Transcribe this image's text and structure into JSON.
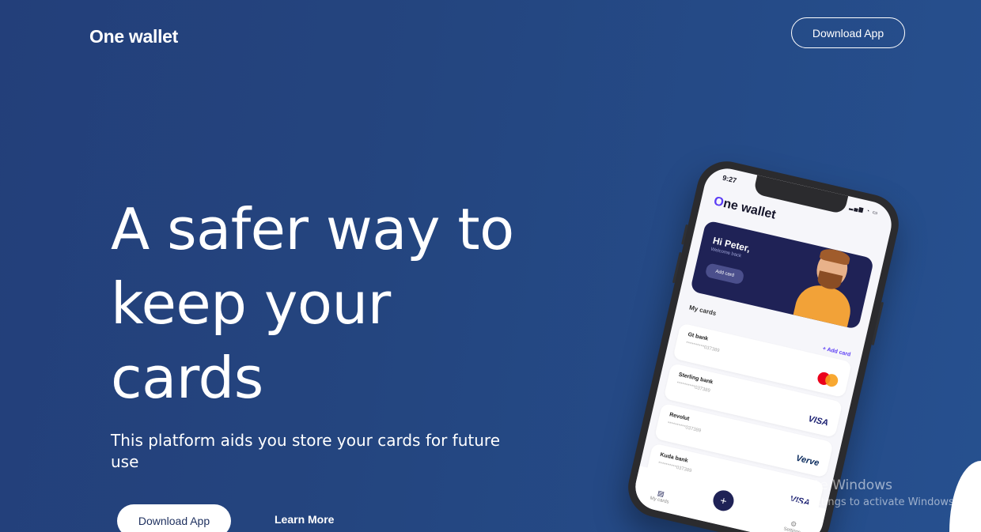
{
  "header": {
    "logo": "One wallet",
    "download_label": "Download App"
  },
  "hero": {
    "title": "A safer way to keep your cards",
    "subtitle": "This platform aids you store your cards for future use",
    "primary_button": "Download App",
    "secondary_link": "Learn More"
  },
  "phone": {
    "status_time": "9:27",
    "app_logo_rest": "ne wallet",
    "app_logo_o": "O",
    "greeting": "Hi Peter,",
    "welcome": "Welcome back",
    "add_card_button": "Add card",
    "section_title": "My cards",
    "add_card_link": "+ Add card",
    "cards": [
      {
        "name": "Gt bank",
        "number": "**********037389",
        "brand": "mastercard"
      },
      {
        "name": "Sterling bank",
        "number": "**********037389",
        "brand": "VISA"
      },
      {
        "name": "Revolut",
        "number": "**********037389",
        "brand": "Verve"
      },
      {
        "name": "Kuda bank",
        "number": "**********037389",
        "brand": "VISA"
      }
    ],
    "nav": {
      "my_cards": "My cards",
      "add": "+",
      "settings": "Settings"
    }
  },
  "watermark": {
    "title": "Activate Windows",
    "subtitle": "Go to Settings to activate Windows."
  },
  "colors": {
    "background": "#24457f",
    "card_dark": "#1f2256",
    "accent": "#5b3cf5"
  }
}
